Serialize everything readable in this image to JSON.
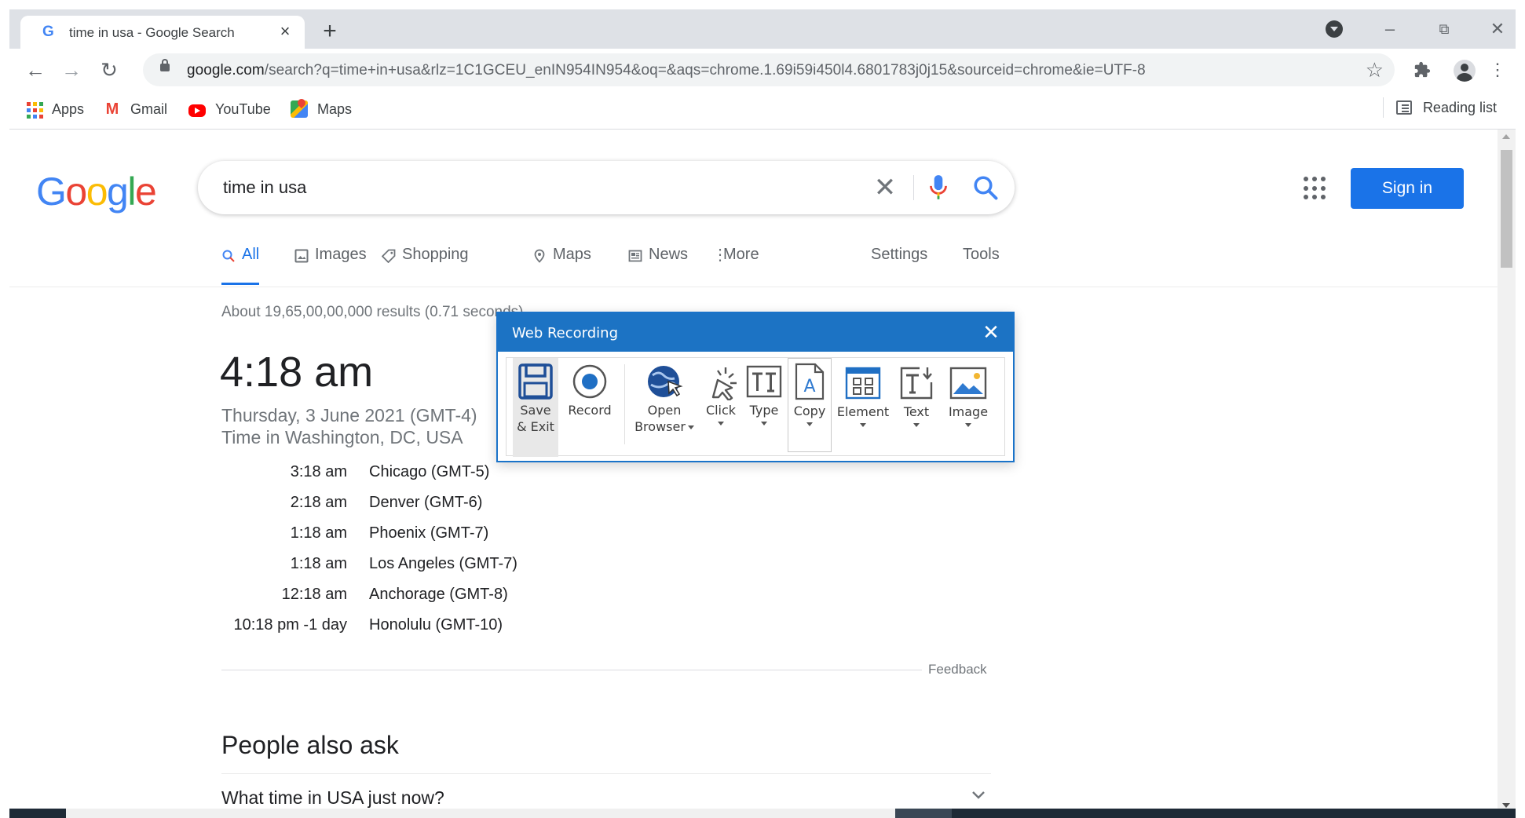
{
  "browser": {
    "tab_title": "time in usa - Google Search",
    "tab_close": "×",
    "new_tab": "+",
    "url_host": "google.com",
    "url_rest": "/search?q=time+in+usa&rlz=1C1GCEU_enIN954IN954&oq=&aqs=chrome.1.69i59i450l4.6801783j0j15&sourceid=chrome&ie=UTF-8",
    "bookmarks": [
      {
        "label": "Apps",
        "icon": "apps-icon"
      },
      {
        "label": "Gmail",
        "icon": "gmail-icon"
      },
      {
        "label": "YouTube",
        "icon": "youtube-icon"
      },
      {
        "label": "Maps",
        "icon": "maps-icon"
      }
    ],
    "reading_list": "Reading list"
  },
  "google": {
    "logo_letters": [
      "G",
      "o",
      "o",
      "g",
      "l",
      "e"
    ],
    "logo_colors": [
      "#4285f4",
      "#ea4335",
      "#fbbc05",
      "#4285f4",
      "#34a853",
      "#ea4335"
    ],
    "query": "time in usa",
    "sign_in": "Sign in",
    "tabs": [
      "All",
      "Images",
      "Shopping",
      "Maps",
      "News",
      "More"
    ],
    "settings": "Settings",
    "tools": "Tools",
    "results_count": "About 19,65,00,00,000 results (0.71 seconds)",
    "time_big": "4:18 am",
    "date_line": "Thursday, 3 June 2021 (GMT-4)",
    "location_line": "Time in Washington, DC, USA",
    "time_rows": [
      {
        "time": "3:18 am",
        "city": "Chicago (GMT-5)"
      },
      {
        "time": "2:18 am",
        "city": "Denver (GMT-6)"
      },
      {
        "time": "1:18 am",
        "city": "Phoenix (GMT-7)"
      },
      {
        "time": "1:18 am",
        "city": "Los Angeles (GMT-7)"
      },
      {
        "time": "12:18 am",
        "city": "Anchorage (GMT-8)"
      },
      {
        "time": "10:18 pm -1 day",
        "city": "Honolulu (GMT-10)"
      }
    ],
    "feedback": "Feedback",
    "people_also_ask": "People also ask",
    "paa_question": "What time in USA just now?"
  },
  "web_recording": {
    "title": "Web Recording",
    "buttons": {
      "save_exit_1": "Save",
      "save_exit_2": "& Exit",
      "record": "Record",
      "open_browser_1": "Open",
      "open_browser_2": "Browser",
      "click": "Click",
      "type": "Type",
      "copy": "Copy",
      "element": "Element",
      "text": "Text",
      "image": "Image"
    }
  },
  "colors": {
    "accent": "#1a73e8",
    "recorder_header": "#1c73c4"
  }
}
